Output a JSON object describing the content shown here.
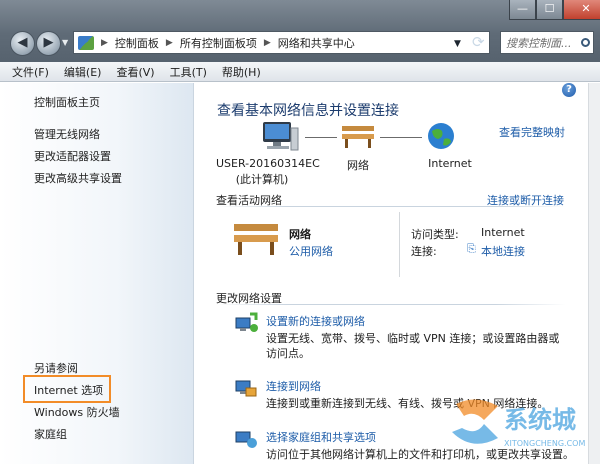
{
  "window": {
    "controls": [
      "—",
      "☐",
      "✕"
    ]
  },
  "nav": {
    "back_label": "◀",
    "forward_label": "▶"
  },
  "address": {
    "crumbs": [
      "控制面板",
      "所有控制面板项",
      "网络和共享中心"
    ]
  },
  "search": {
    "placeholder": "搜索控制面..."
  },
  "menu": [
    "文件(F)",
    "编辑(E)",
    "查看(V)",
    "工具(T)",
    "帮助(H)"
  ],
  "sidebar": {
    "home": "控制面板主页",
    "links": [
      "管理无线网络",
      "更改适配器设置",
      "更改高级共享设置"
    ],
    "see_also_title": "另请参阅",
    "see_also": [
      "Internet 选项",
      "Windows 防火墙",
      "家庭组"
    ],
    "highlight_color": "#f28c28"
  },
  "main": {
    "title": "查看基本网络信息并设置连接",
    "view_full_map": "查看完整映射",
    "map": {
      "computer_name": "USER-20160314EC",
      "computer_sub": "(此计算机)",
      "network": "网络",
      "internet": "Internet"
    },
    "active_networks": {
      "title": "查看活动网络",
      "connect_disconnect": "连接或断开连接",
      "network_name": "网络",
      "network_type": "公用网络",
      "access_type_label": "访问类型:",
      "access_type_value": "Internet",
      "connections_label": "连接:",
      "connections_value": "本地连接"
    },
    "change_settings": {
      "title": "更改网络设置",
      "items": [
        {
          "title": "设置新的连接或网络",
          "desc1": "设置无线、宽带、拨号、临时或 VPN 连接；或设置路由器或",
          "desc2": "访问点。",
          "icon": "network-setup-icon"
        },
        {
          "title": "连接到网络",
          "desc1": "连接到或重新连接到无线、有线、拨号或 VPN 网络连接。",
          "desc2": "",
          "icon": "connect-network-icon"
        },
        {
          "title": "选择家庭组和共享选项",
          "desc1": "访问位于其他网络计算机上的文件和打印机，或更改共享设置。",
          "desc2": "",
          "icon": "homegroup-icon"
        }
      ]
    },
    "help_icon": "?"
  },
  "watermark": {
    "text": "系统城",
    "sub": "XITONGCHENG.COM"
  }
}
